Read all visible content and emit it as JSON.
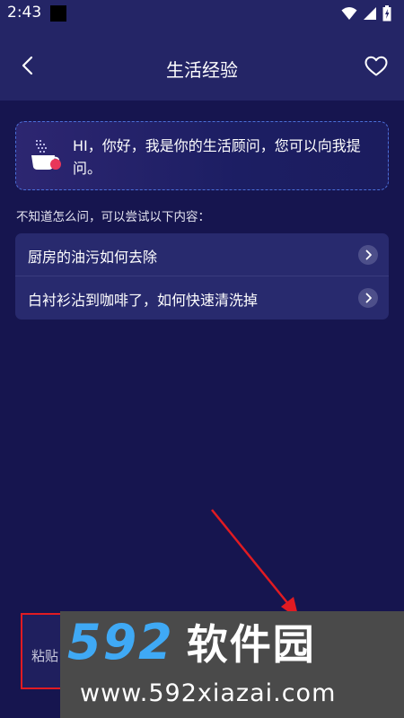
{
  "status_bar": {
    "time": "2:43",
    "icons": [
      "wifi-icon",
      "signal-icon",
      "battery-icon"
    ]
  },
  "app_bar": {
    "title": "生活经验",
    "icons": [
      "back-arrow-icon",
      "heart-icon"
    ]
  },
  "greeting": {
    "text": "HI，你好，我是你的生活顾问，您可以向我提问。",
    "icon": "coffee-cup-icon"
  },
  "hint": "不知道怎么问，可以尝试以下内容：",
  "suggestions": [
    {
      "label": "厨房的油污如何去除"
    },
    {
      "label": "白衬衫沾到咖啡了，如何快速清洗掉"
    }
  ],
  "input": {
    "paste_label": "粘贴"
  },
  "watermark": {
    "digits": "592",
    "brand": "软件园",
    "url": "www.592xiazai.com"
  },
  "colors": {
    "background": "#16154f",
    "header": "#242566",
    "card_border": "#4b6fd9",
    "suggestion_bg": "#282a6e",
    "annotation_red": "#e11b22",
    "watermark_blue": "#3fa9f5"
  }
}
